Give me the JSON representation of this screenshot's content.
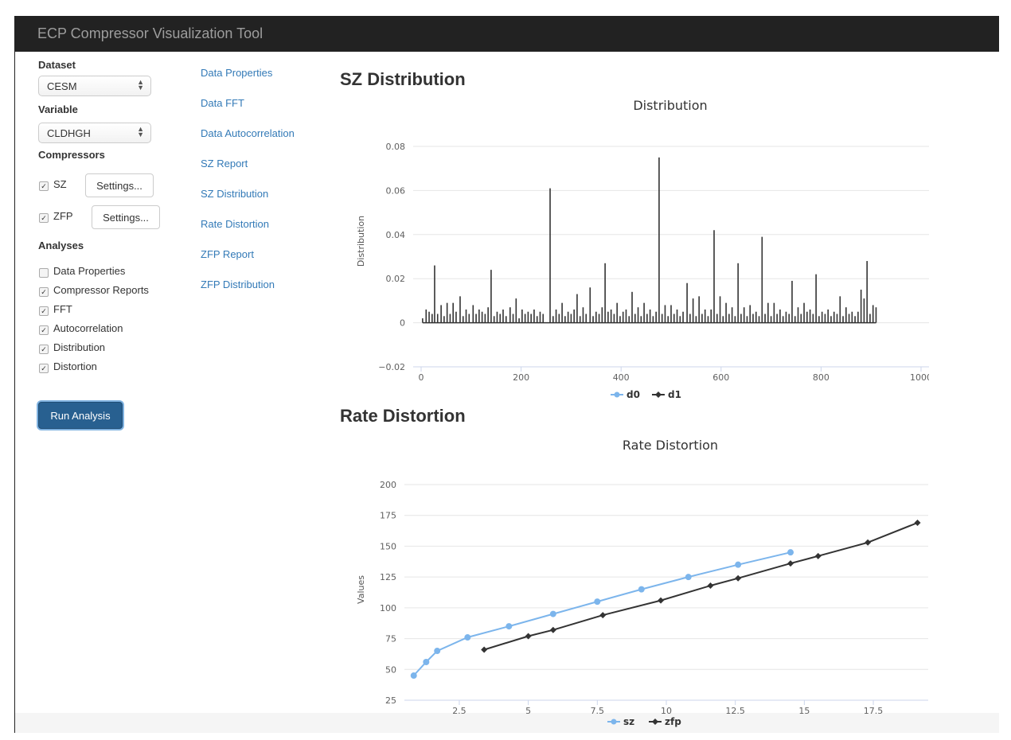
{
  "app": {
    "title": "ECP Compressor Visualization Tool"
  },
  "sidebar": {
    "dataset_label": "Dataset",
    "dataset_value": "CESM",
    "variable_label": "Variable",
    "variable_value": "CLDHGH",
    "compressors_label": "Compressors",
    "compressors": [
      {
        "name": "SZ",
        "checked": true,
        "settings_label": "Settings..."
      },
      {
        "name": "ZFP",
        "checked": true,
        "settings_label": "Settings..."
      }
    ],
    "analyses_label": "Analyses",
    "analyses": [
      {
        "label": "Data Properties",
        "checked": false
      },
      {
        "label": "Compressor Reports",
        "checked": true
      },
      {
        "label": "FFT",
        "checked": true
      },
      {
        "label": "Autocorrelation",
        "checked": true
      },
      {
        "label": "Distribution",
        "checked": true
      },
      {
        "label": "Distortion",
        "checked": true
      }
    ],
    "run_label": "Run Analysis"
  },
  "nav": {
    "links": [
      "Data Properties",
      "Data FFT",
      "Data Autocorrelation",
      "SZ Report",
      "SZ Distribution",
      "Rate Distortion",
      "ZFP Report",
      "ZFP Distribution"
    ]
  },
  "sections": {
    "sz_distribution_heading": "SZ Distribution",
    "rate_distortion_heading": "Rate Distortion"
  },
  "colors": {
    "navbar": "#222222",
    "link": "#337ab7",
    "primary": "#286090",
    "series_light": "#7cb5ec",
    "series_dark": "#333333"
  },
  "chart_data": [
    {
      "type": "line",
      "title": "Distribution",
      "xlabel": "",
      "ylabel": "Distribution",
      "xlim": [
        0,
        1000
      ],
      "ylim": [
        -0.02,
        0.08
      ],
      "x_ticks": [
        0,
        200,
        400,
        600,
        800,
        1000
      ],
      "y_ticks": [
        -0.02,
        0,
        0.02,
        0.04,
        0.06,
        0.08
      ],
      "y_tick_labels": [
        "−0.02",
        "0",
        "0.02",
        "0.04",
        "0.06",
        "0.08"
      ],
      "legend": [
        "d0",
        "d1"
      ],
      "legend_position": "bottom-center",
      "spikes": [
        [
          3,
          0.002
        ],
        [
          10,
          0.006
        ],
        [
          16,
          0.005
        ],
        [
          22,
          0.004
        ],
        [
          27,
          0.026
        ],
        [
          33,
          0.004
        ],
        [
          40,
          0.008
        ],
        [
          46,
          0.003
        ],
        [
          52,
          0.009
        ],
        [
          58,
          0.004
        ],
        [
          64,
          0.009
        ],
        [
          70,
          0.005
        ],
        [
          78,
          0.012
        ],
        [
          84,
          0.003
        ],
        [
          90,
          0.006
        ],
        [
          96,
          0.004
        ],
        [
          104,
          0.008
        ],
        [
          110,
          0.004
        ],
        [
          116,
          0.006
        ],
        [
          122,
          0.005
        ],
        [
          128,
          0.004
        ],
        [
          134,
          0.007
        ],
        [
          140,
          0.024
        ],
        [
          146,
          0.003
        ],
        [
          152,
          0.005
        ],
        [
          158,
          0.004
        ],
        [
          164,
          0.006
        ],
        [
          170,
          0.003
        ],
        [
          178,
          0.007
        ],
        [
          184,
          0.004
        ],
        [
          190,
          0.011
        ],
        [
          196,
          0.002
        ],
        [
          202,
          0.006
        ],
        [
          208,
          0.004
        ],
        [
          214,
          0.005
        ],
        [
          220,
          0.004
        ],
        [
          226,
          0.006
        ],
        [
          232,
          0.003
        ],
        [
          238,
          0.005
        ],
        [
          244,
          0.004
        ],
        [
          258,
          0.061
        ],
        [
          264,
          0.003
        ],
        [
          270,
          0.006
        ],
        [
          276,
          0.004
        ],
        [
          282,
          0.009
        ],
        [
          288,
          0.003
        ],
        [
          294,
          0.005
        ],
        [
          300,
          0.004
        ],
        [
          306,
          0.006
        ],
        [
          312,
          0.013
        ],
        [
          318,
          0.003
        ],
        [
          324,
          0.007
        ],
        [
          330,
          0.004
        ],
        [
          338,
          0.016
        ],
        [
          344,
          0.003
        ],
        [
          350,
          0.005
        ],
        [
          356,
          0.004
        ],
        [
          362,
          0.007
        ],
        [
          368,
          0.027
        ],
        [
          374,
          0.005
        ],
        [
          380,
          0.006
        ],
        [
          386,
          0.004
        ],
        [
          392,
          0.009
        ],
        [
          398,
          0.003
        ],
        [
          404,
          0.005
        ],
        [
          410,
          0.006
        ],
        [
          416,
          0.003
        ],
        [
          422,
          0.014
        ],
        [
          428,
          0.004
        ],
        [
          434,
          0.007
        ],
        [
          440,
          0.003
        ],
        [
          446,
          0.009
        ],
        [
          452,
          0.004
        ],
        [
          458,
          0.006
        ],
        [
          464,
          0.003
        ],
        [
          470,
          0.005
        ],
        [
          476,
          0.075
        ],
        [
          482,
          0.004
        ],
        [
          488,
          0.008
        ],
        [
          494,
          0.003
        ],
        [
          500,
          0.008
        ],
        [
          506,
          0.004
        ],
        [
          512,
          0.006
        ],
        [
          518,
          0.003
        ],
        [
          524,
          0.005
        ],
        [
          532,
          0.018
        ],
        [
          538,
          0.004
        ],
        [
          544,
          0.011
        ],
        [
          550,
          0.003
        ],
        [
          556,
          0.012
        ],
        [
          562,
          0.004
        ],
        [
          568,
          0.006
        ],
        [
          574,
          0.003
        ],
        [
          580,
          0.006
        ],
        [
          586,
          0.042
        ],
        [
          592,
          0.004
        ],
        [
          598,
          0.012
        ],
        [
          604,
          0.003
        ],
        [
          610,
          0.009
        ],
        [
          616,
          0.004
        ],
        [
          622,
          0.007
        ],
        [
          628,
          0.003
        ],
        [
          634,
          0.027
        ],
        [
          640,
          0.004
        ],
        [
          646,
          0.007
        ],
        [
          652,
          0.003
        ],
        [
          658,
          0.008
        ],
        [
          664,
          0.004
        ],
        [
          670,
          0.005
        ],
        [
          676,
          0.003
        ],
        [
          682,
          0.039
        ],
        [
          688,
          0.004
        ],
        [
          694,
          0.009
        ],
        [
          700,
          0.003
        ],
        [
          706,
          0.009
        ],
        [
          712,
          0.004
        ],
        [
          718,
          0.006
        ],
        [
          724,
          0.003
        ],
        [
          730,
          0.005
        ],
        [
          736,
          0.004
        ],
        [
          742,
          0.019
        ],
        [
          748,
          0.003
        ],
        [
          754,
          0.007
        ],
        [
          760,
          0.004
        ],
        [
          766,
          0.009
        ],
        [
          772,
          0.005
        ],
        [
          778,
          0.006
        ],
        [
          784,
          0.004
        ],
        [
          790,
          0.022
        ],
        [
          796,
          0.003
        ],
        [
          802,
          0.005
        ],
        [
          808,
          0.004
        ],
        [
          814,
          0.006
        ],
        [
          820,
          0.003
        ],
        [
          826,
          0.005
        ],
        [
          832,
          0.004
        ],
        [
          838,
          0.012
        ],
        [
          844,
          0.003
        ],
        [
          850,
          0.007
        ],
        [
          856,
          0.004
        ],
        [
          862,
          0.005
        ],
        [
          868,
          0.003
        ],
        [
          874,
          0.005
        ],
        [
          880,
          0.015
        ],
        [
          886,
          0.011
        ],
        [
          892,
          0.028
        ],
        [
          898,
          0.004
        ],
        [
          904,
          0.008
        ],
        [
          910,
          0.007
        ]
      ]
    },
    {
      "type": "line",
      "title": "Rate Distortion",
      "xlabel": "",
      "ylabel": "Values",
      "xlim": [
        0.8,
        19.2
      ],
      "ylim": [
        25,
        200
      ],
      "x_ticks": [
        2.5,
        5,
        7.5,
        10,
        12.5,
        15,
        17.5
      ],
      "y_ticks": [
        25,
        50,
        75,
        100,
        125,
        150,
        175,
        200
      ],
      "legend_position": "bottom-center",
      "series": [
        {
          "name": "sz",
          "color": "#7cb5ec",
          "marker": "circle",
          "points": [
            [
              0.85,
              45
            ],
            [
              1.3,
              56
            ],
            [
              1.7,
              65
            ],
            [
              2.8,
              76
            ],
            [
              4.3,
              85
            ],
            [
              5.9,
              95
            ],
            [
              7.5,
              105
            ],
            [
              9.1,
              115
            ],
            [
              10.8,
              125
            ],
            [
              12.6,
              135
            ],
            [
              14.5,
              145
            ]
          ]
        },
        {
          "name": "zfp",
          "color": "#333333",
          "marker": "diamond",
          "points": [
            [
              3.4,
              66
            ],
            [
              5.0,
              77
            ],
            [
              5.9,
              82
            ],
            [
              7.7,
              94
            ],
            [
              9.8,
              106
            ],
            [
              11.6,
              118
            ],
            [
              12.6,
              124
            ],
            [
              14.5,
              136
            ],
            [
              15.5,
              142
            ],
            [
              17.3,
              153
            ],
            [
              19.1,
              169
            ]
          ]
        }
      ]
    }
  ]
}
